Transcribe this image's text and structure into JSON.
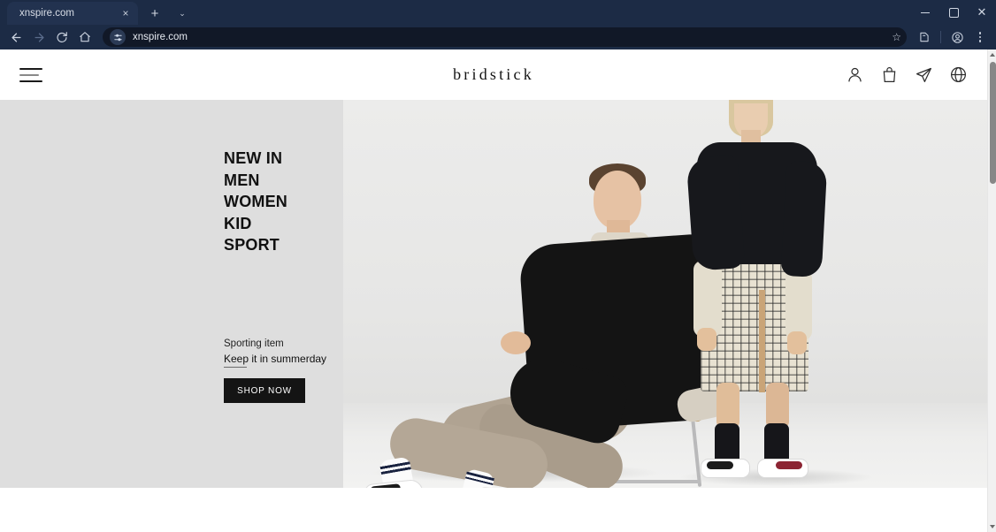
{
  "browser": {
    "tab": {
      "title": "xnspire.com",
      "close_label": "×"
    },
    "new_tab_label": "+",
    "tab_list_label": "⌄",
    "window_controls": {
      "minimize": "—",
      "maximize": "□",
      "close": "✕"
    },
    "toolbar": {
      "back_label": "←",
      "forward_label": "→",
      "reload_label": "↻",
      "home_label": "⌂",
      "site_info_label": "site-settings",
      "url": "xnspire.com",
      "bookmark_label": "☆",
      "extensions_label": "extensions",
      "profile_label": "profile",
      "menu_label": "⋮"
    },
    "scrollbar": {
      "up_label": "▲",
      "down_label": "▼"
    }
  },
  "site": {
    "brand": "bridstick",
    "menu_label": "menu",
    "header_icons": [
      {
        "name": "account-icon",
        "label": "Account"
      },
      {
        "name": "bag-icon",
        "label": "Bag"
      },
      {
        "name": "send-icon",
        "label": "Send"
      },
      {
        "name": "globe-icon",
        "label": "Language"
      }
    ],
    "nav": [
      {
        "label": "NEW IN"
      },
      {
        "label": "MEN"
      },
      {
        "label": "WOMEN"
      },
      {
        "label": "KID"
      },
      {
        "label": "SPORT"
      }
    ],
    "promo": {
      "line1": "Sporting item",
      "line2": "Keep it in summerday",
      "cta": "SHOP NOW"
    },
    "hero_image_alt": "Two models in black tops, one seated on a cane chair",
    "colors": {
      "panel_bg": "#dedede",
      "cta_bg": "#141414",
      "cta_text": "#ffffff",
      "text": "#111111"
    }
  }
}
